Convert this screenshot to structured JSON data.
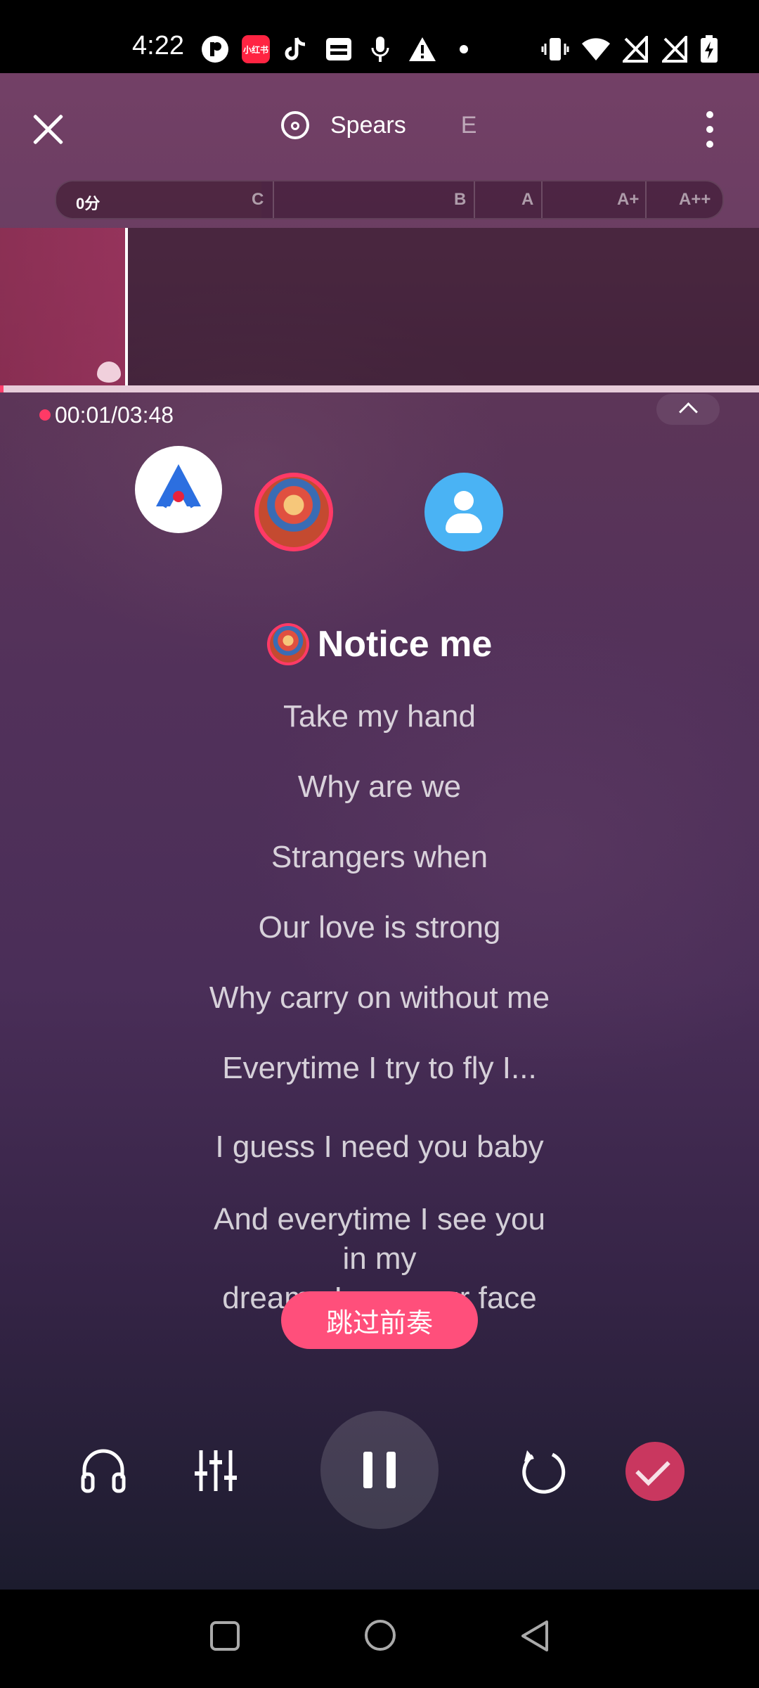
{
  "status_bar": {
    "time": "4:22",
    "app_icons": [
      "p-icon",
      "rednote-icon",
      "tiktok-icon",
      "card-icon",
      "mic-icon",
      "warning-icon",
      "dot-icon"
    ],
    "rednote_label": "小红书",
    "system_icons": [
      "vibrate-icon",
      "wifi-icon",
      "no-signal-icon",
      "no-signal-icon",
      "battery-charging-icon"
    ]
  },
  "header": {
    "current_song": "Spears",
    "next_song": "E"
  },
  "score": {
    "current": "0分",
    "grades": [
      "C",
      "B",
      "A",
      "A+",
      "A++"
    ]
  },
  "playback": {
    "elapsed": "00:01",
    "separator": "/",
    "total": "03:48",
    "progress_fraction": 0.005
  },
  "lyrics": {
    "current": "Notice me",
    "upcoming": [
      "Take my hand",
      "Why are we",
      "Strangers when",
      "Our love is strong",
      "Why carry on without me",
      "Everytime I try to fly I...",
      "I guess I need you baby"
    ],
    "multiline": [
      "And everytime I see you",
      "in my",
      "dreams I see your face"
    ]
  },
  "skip_intro_label": "跳过前奏",
  "colors": {
    "accent": "#ff4f7b",
    "record_dot": "#ff3a66",
    "finish_button": "#c9375f",
    "avatar_blue": "#4ab3f4"
  }
}
